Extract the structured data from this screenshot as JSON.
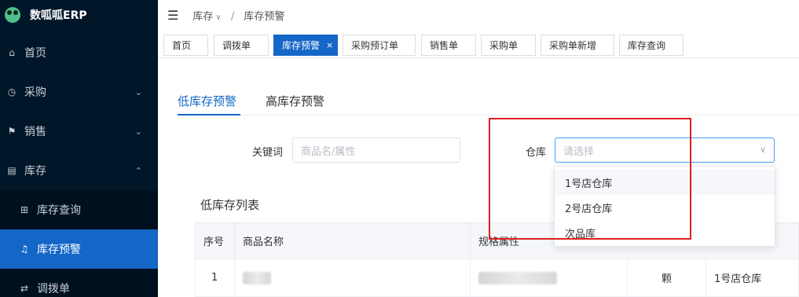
{
  "app": {
    "title": "数呱呱ERP"
  },
  "sidebar": {
    "items": [
      {
        "label": "首页",
        "icon": "home-icon"
      },
      {
        "label": "采购",
        "icon": "clock-icon"
      },
      {
        "label": "销售",
        "icon": "flag-icon"
      },
      {
        "label": "库存",
        "icon": "box-icon"
      },
      {
        "label": "库存查询",
        "icon": "grid-icon"
      },
      {
        "label": "库存预警",
        "icon": "bell-icon"
      },
      {
        "label": "调拨单",
        "icon": "swap-icon"
      }
    ]
  },
  "header": {
    "breadcrumb": [
      "库存",
      "库存预警"
    ]
  },
  "tabs": [
    {
      "label": "首页"
    },
    {
      "label": "调拨单"
    },
    {
      "label": "库存预警"
    },
    {
      "label": "采购预订单"
    },
    {
      "label": "销售单"
    },
    {
      "label": "采购单"
    },
    {
      "label": "采购单新增"
    },
    {
      "label": "库存查询"
    }
  ],
  "subtabs": [
    "低库存预警",
    "高库存预警"
  ],
  "filters": {
    "keyword_label": "关键词",
    "keyword_placeholder": "商品名/属性",
    "warehouse_label": "仓库",
    "warehouse_placeholder": "请选择",
    "warehouse_options": [
      "1号店仓库",
      "2号店仓库",
      "次品库"
    ]
  },
  "list": {
    "title": "低库存列表",
    "columns": [
      "序号",
      "商品名称",
      "规格属性"
    ],
    "rows": [
      {
        "index": "1",
        "unit": "颗",
        "warehouse": "1号店仓库"
      }
    ]
  }
}
